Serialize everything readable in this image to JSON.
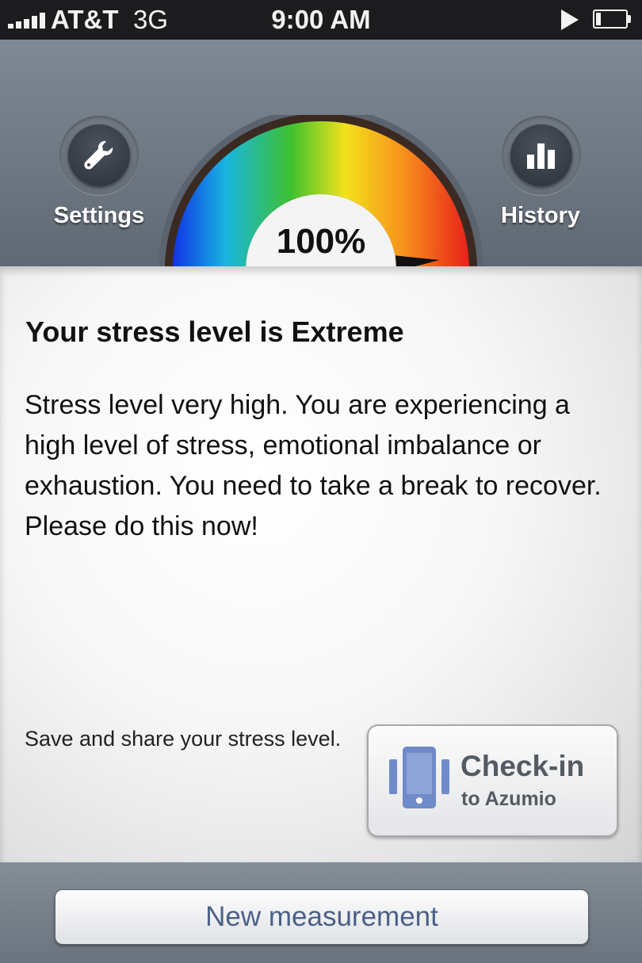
{
  "status_bar": {
    "carrier": "AT&T",
    "network": "3G",
    "time": "9:00 AM",
    "signal_icon": "signal-bars-icon",
    "play_icon": "play-icon",
    "battery_icon": "battery-icon"
  },
  "header": {
    "settings": {
      "label": "Settings",
      "icon": "wrench-icon"
    },
    "history": {
      "label": "History",
      "icon": "bar-chart-icon"
    },
    "gauge": {
      "value_text": "100%",
      "level_fraction": 1.0,
      "colors": [
        "#1033e6",
        "#19b6e0",
        "#3ec12e",
        "#f2e21b",
        "#f7901c",
        "#e8201a"
      ]
    }
  },
  "result": {
    "title": "Your stress level is Extreme",
    "description": "Stress level very high. You are experiencing a high level of stress, emotional imbalance or exhaustion. You need to take a break to recover. Please do this now!",
    "share_text": "Save and share your stress level.",
    "checkin_button": {
      "label": "Check-in",
      "sublabel": "to Azumio",
      "icon": "phone-icon",
      "accent": "#6f8bc9"
    }
  },
  "footer": {
    "new_measurement_label": "New measurement"
  }
}
